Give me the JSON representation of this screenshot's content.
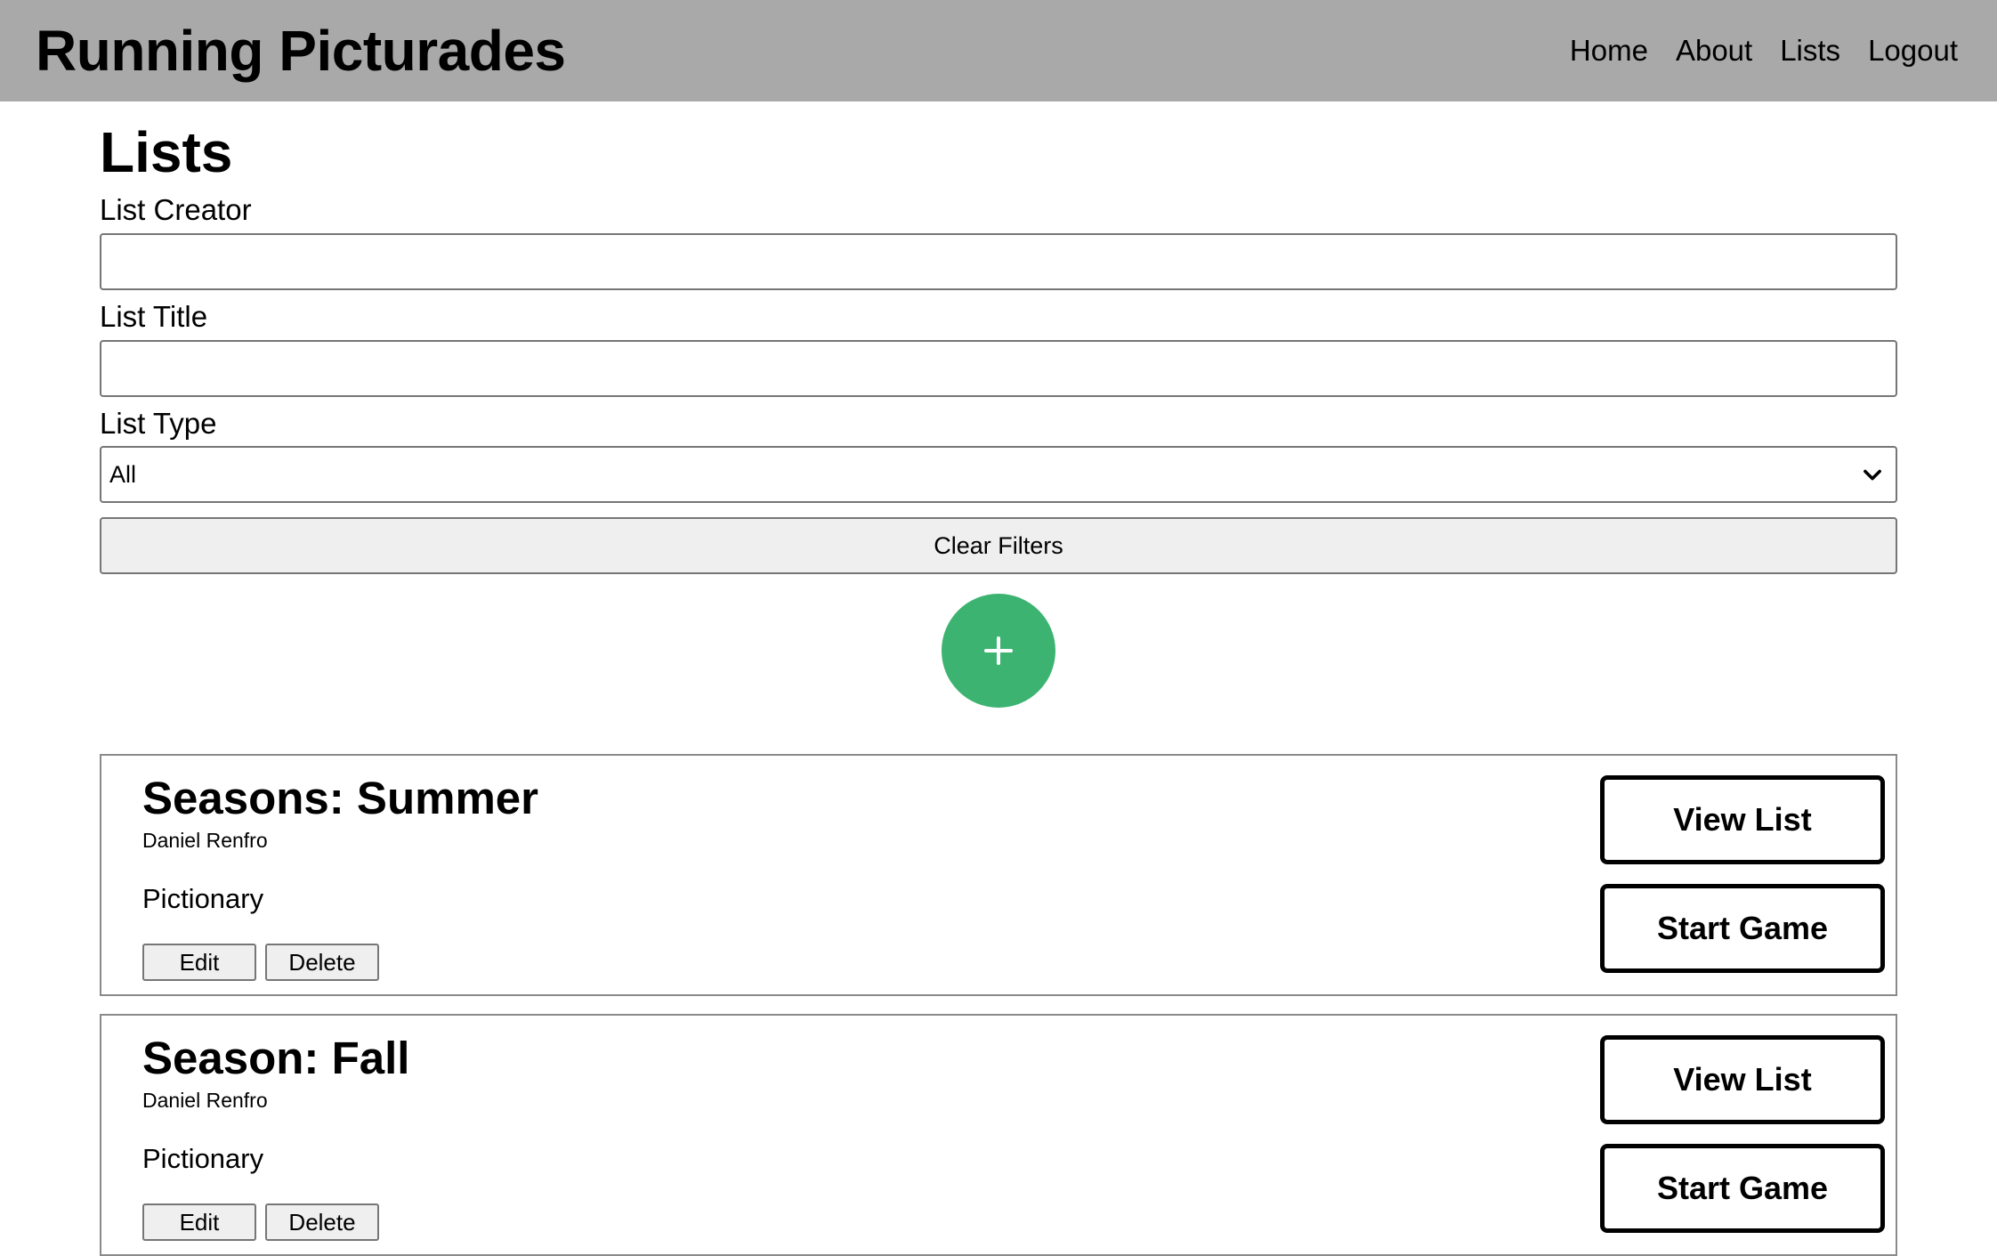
{
  "header": {
    "brand": "Running Picturades",
    "nav": [
      {
        "label": "Home"
      },
      {
        "label": "About"
      },
      {
        "label": "Lists"
      },
      {
        "label": "Logout"
      }
    ]
  },
  "main": {
    "title": "Lists",
    "filters": {
      "creator_label": "List Creator",
      "creator_value": "",
      "title_label": "List Title",
      "title_value": "",
      "type_label": "List Type",
      "type_selected": "All",
      "clear_label": "Clear Filters"
    },
    "add_button": {
      "icon": "plus-icon",
      "color": "#3cb371"
    },
    "lists": [
      {
        "title": "Seasons: Summer",
        "creator": "Daniel Renfro",
        "type": "Pictionary",
        "edit_label": "Edit",
        "delete_label": "Delete",
        "view_label": "View List",
        "start_label": "Start Game"
      },
      {
        "title": "Season: Fall",
        "creator": "Daniel Renfro",
        "type": "Pictionary",
        "edit_label": "Edit",
        "delete_label": "Delete",
        "view_label": "View List",
        "start_label": "Start Game"
      }
    ]
  },
  "colors": {
    "navbar_bg": "#a9a9a9",
    "accent_green": "#3cb371"
  }
}
